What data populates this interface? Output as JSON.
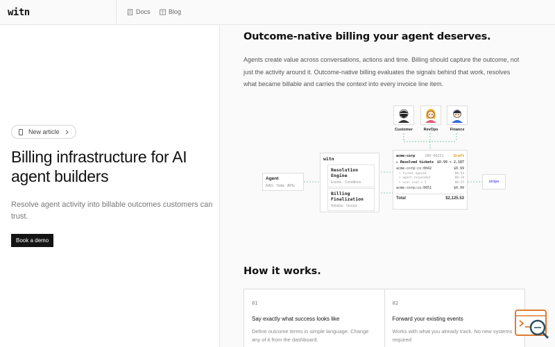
{
  "header": {
    "logo": "witn",
    "nav": [
      {
        "label": "Docs",
        "icon": "document-icon"
      },
      {
        "label": "Blog",
        "icon": "book-icon"
      }
    ]
  },
  "hero": {
    "pill_label": "New article",
    "title": "Billing infrastructure for AI agent builders",
    "subtitle": "Resolve agent activity into billable outcomes customers can trust.",
    "cta": "Book a demo"
  },
  "section": {
    "title": "Outcome-native billing your agent deserves.",
    "paragraph": "Agents create value across conversations, actions and time. Billing should capture the outcome, not just the activity around it. Outcome-native billing evaluates the signals behind that work, resolves what became billable and carries the context into every invoice line item."
  },
  "diagram": {
    "personas": [
      "Customer",
      "RevOps",
      "Finance"
    ],
    "agent": {
      "title": "Agent",
      "sub": "RAG · Tools · APIs"
    },
    "witn": {
      "title": "witn",
      "engines": [
        {
          "title": "Resolution Engine",
          "sub": "Events · Conditions"
        },
        {
          "title": "Billing Finalization",
          "sub": "Window · Invoice"
        }
      ]
    },
    "invoice": {
      "customer": "acme-corp",
      "number": "INV-00251",
      "status": "Draft",
      "resolved_label": "▸ Resolved tickets",
      "resolved_value": "$0.99 × 2,187",
      "line1_id": "acme-corp:cs:0042",
      "line1_amount": "$0.99",
      "sub1": "• ticket.opened",
      "sub1_v": "00:54",
      "sub2": "• agent.responded",
      "sub2_v": "00:19",
      "sub3": "• user.csat = 5",
      "sub3_v": "00:25",
      "line2_id": "acme-corp:cs:0051",
      "line2_amount": "$0.99",
      "total_label": "Total",
      "total_value": "$2,125.53"
    },
    "stripe": "stripe"
  },
  "how": {
    "title": "How it works.",
    "cards": [
      {
        "num": "01",
        "title": "Say exactly what success looks like",
        "desc": "Define outcome terms in simple language. Change any of it from the dashboard."
      },
      {
        "num": "02",
        "title": "Forward your existing events",
        "desc": "Works with what you already track. No new systems required"
      }
    ]
  }
}
